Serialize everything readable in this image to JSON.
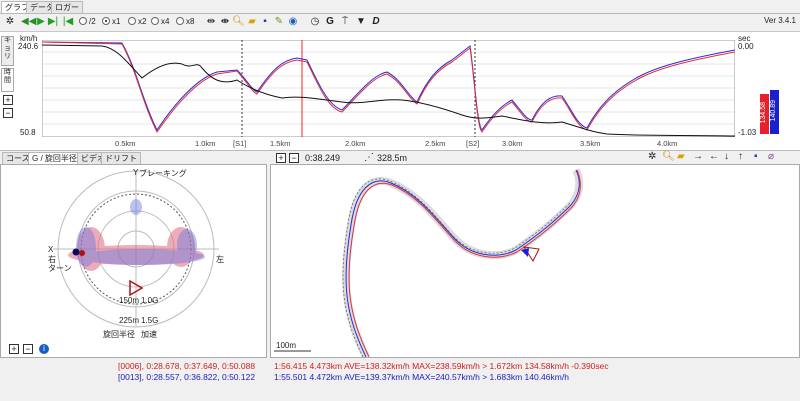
{
  "tabs": [
    "グラフ",
    "データ",
    "ロガー"
  ],
  "toolbar": {
    "icons": [
      "settings-icon",
      "skip-back-icon",
      "play-icon",
      "step-forward-icon",
      "step-back-icon",
      "expand-icon",
      "shrink-icon",
      "search-icon",
      "open-folder-icon",
      "save-icon",
      "pen-icon",
      "globe-icon",
      "stopwatch-icon",
      "g-icon",
      "gps-icon",
      "triangle-down-icon",
      "d-icon"
    ],
    "speeds": [
      {
        "label": "/2",
        "checked": false
      },
      {
        "label": "x1",
        "checked": true
      },
      {
        "label": "x2",
        "checked": false
      },
      {
        "label": "x4",
        "checked": false
      },
      {
        "label": "x8",
        "checked": false
      }
    ],
    "version": "Ver 3.4.1"
  },
  "graph": {
    "y_unit_left": "km/h",
    "y_top": "240.6",
    "y_bottom": "50.8",
    "y_unit_right": "sec",
    "y_right_top": "0.00",
    "y_right_bottom": "-1.03",
    "vtab_top": "キョリ",
    "vtab_bottom": "時間",
    "x_labels": [
      "0.5km",
      "1.0km",
      "[S1]",
      "1.5km",
      "2.0km",
      "2.5km",
      "[S2]",
      "3.0km",
      "3.5km",
      "4.0km"
    ],
    "bar_red_label": "134.58",
    "bar_blue_label": "140.89",
    "colors": {
      "lap_red": "#e0303a",
      "lap_blue": "#2b2bd6",
      "delta": "#111111",
      "cursor": "#ff2020"
    }
  },
  "left_panel": {
    "tabs": [
      "コース",
      "G / 旋回半径",
      "ビデオ",
      "ドリフト"
    ],
    "labels": {
      "top": "Y",
      "braking": "ブレーキング",
      "left_axis": "X",
      "right_turn": "右",
      "turn": "ターン",
      "left_dir": "左",
      "r150": "150m",
      "g10": "1.0G",
      "r225": "225m",
      "g15": "1.5G",
      "radius": "旋回半径",
      "accel": "加速"
    }
  },
  "right_panel": {
    "time": "0:38.249",
    "distance": "328.5m",
    "scale": "100m"
  },
  "status": {
    "lap1_left": "[0006], 0:28.678, 0:37.649, 0:50.088",
    "lap1_right": "1:56.415 4.473km AVE=138.32km/h MAX=238.59km/h > 1.672km 134.58km/h -0.390sec",
    "lap2_left": "[0013], 0:28.557, 0:36.822, 0:50.122",
    "lap2_right": "1:55.501 4.472km AVE=139.37km/h MAX=240.57km/h > 1.683km 140.46km/h",
    "lap1_color": "#d02020",
    "lap2_color": "#2020c0"
  }
}
